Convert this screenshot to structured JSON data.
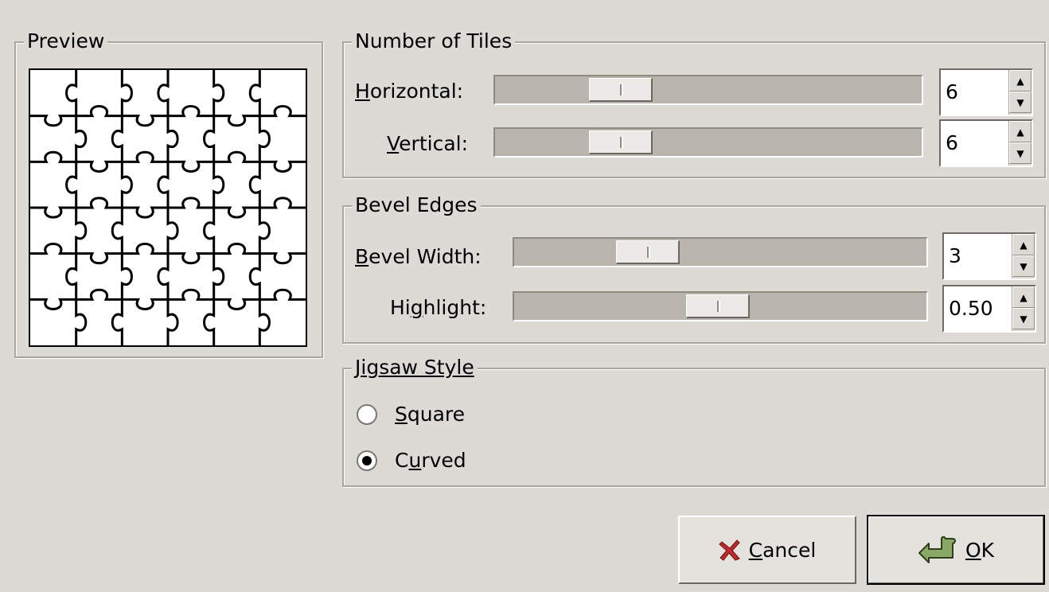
{
  "preview": {
    "label": "Preview",
    "grid_rows": 6,
    "grid_cols": 6
  },
  "tiles": {
    "label": "Number of Tiles",
    "horizontal": {
      "mnemonic": "H",
      "rest": "orizontal:",
      "value": "6"
    },
    "vertical": {
      "mnemonic": "V",
      "rest": "ertical:",
      "value": "6"
    }
  },
  "bevel": {
    "label": "Bevel Edges",
    "width": {
      "mnemonic": "B",
      "rest": "evel Width:",
      "value": "3"
    },
    "highlight": {
      "pre": "Hi",
      "mnemonic": "g",
      "rest": "hlight:",
      "value": "0.50"
    }
  },
  "style": {
    "label": "Jigsaw Style",
    "square": {
      "mnemonic": "S",
      "rest": "quare",
      "checked": false
    },
    "curved": {
      "pre": "C",
      "mnemonic": "u",
      "rest": "rved",
      "checked": true
    }
  },
  "buttons": {
    "cancel": {
      "mnemonic": "C",
      "rest": "ancel"
    },
    "ok": {
      "mnemonic": "O",
      "rest": "K"
    }
  },
  "icons": {
    "cancel": "cancel-x-icon",
    "ok": "ok-check-icon"
  },
  "colors": {
    "background": "#dcdad5",
    "trough": "#b9b5ac",
    "cancel_icon": "#c0282b",
    "ok_icon": "#8aa866"
  }
}
